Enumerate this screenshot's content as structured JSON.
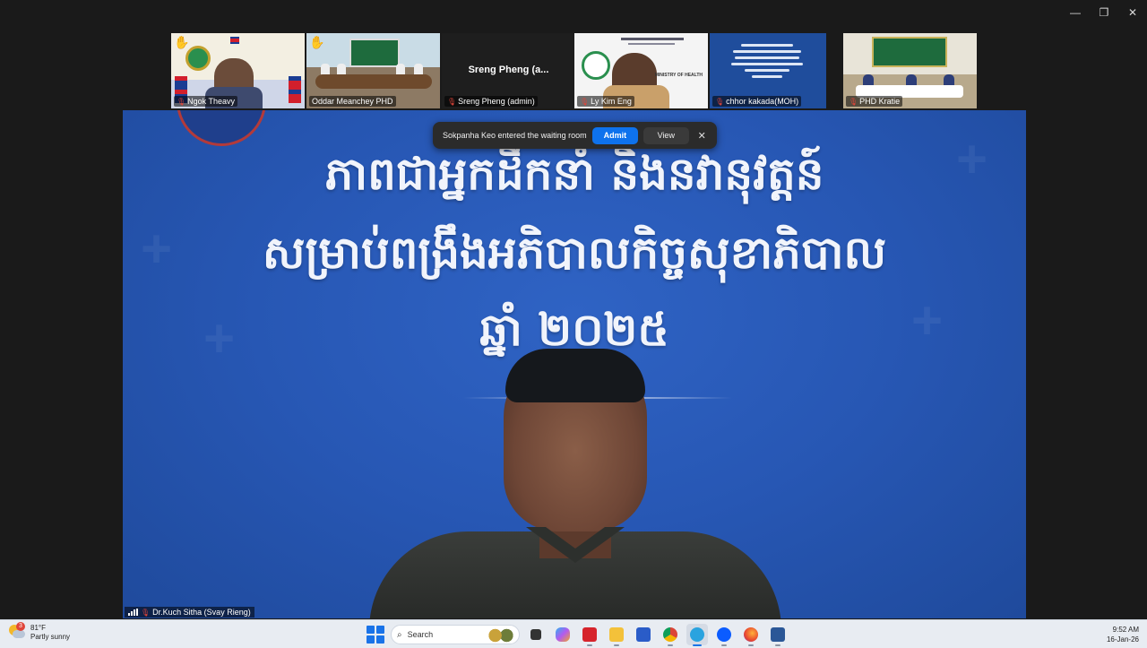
{
  "window": {
    "controls": {
      "minimize": "—",
      "restore": "❐",
      "close": "✕"
    }
  },
  "gallery": [
    {
      "name": "Ngok Theavy",
      "muted": true,
      "hand_raised": true
    },
    {
      "name": "Oddar Meanchey PHD",
      "muted": false,
      "hand_raised": true,
      "active_speaker": true
    },
    {
      "name": "Sreng Pheng (admin)",
      "display_title": "Sreng  Pheng  (a...",
      "muted": true,
      "video_off": true
    },
    {
      "name": "Ly Kim Eng",
      "muted": true,
      "logo_text": "MINISTRY OF HEALTH"
    },
    {
      "name": "chhor kakada(MOH)",
      "muted": true
    },
    {
      "name": "PHD Kratie",
      "muted": true
    }
  ],
  "main": {
    "slide": {
      "line1": "ភាពជាអ្នកដឹកនាំ និងនវានុវត្តន៍",
      "line2": "សម្រាប់ពង្រឹងអភិបាលកិច្ចសុខាភិបាល",
      "line3": "ឆ្នាំ ២០២៥"
    },
    "speaker_name": "Dr.Kuch Sitha (Svay Rieng)",
    "speaker_muted": true
  },
  "toast": {
    "message": "Sokpanha Keo entered the waiting room",
    "admit_label": "Admit",
    "view_label": "View",
    "close_label": "✕"
  },
  "taskbar": {
    "weather": {
      "temp": "81°F",
      "condition": "Partly sunny",
      "badge": "3"
    },
    "search_placeholder": "Search",
    "apps": [
      "file-explorer",
      "copilot",
      "acrobat",
      "folder",
      "store",
      "chrome",
      "telegram",
      "zoom",
      "firefox",
      "word"
    ],
    "time": "9:52 AM",
    "date": "16-Jan-26",
    "colors": {
      "start": "#1a73e8",
      "accent": "#0e72ed"
    }
  }
}
